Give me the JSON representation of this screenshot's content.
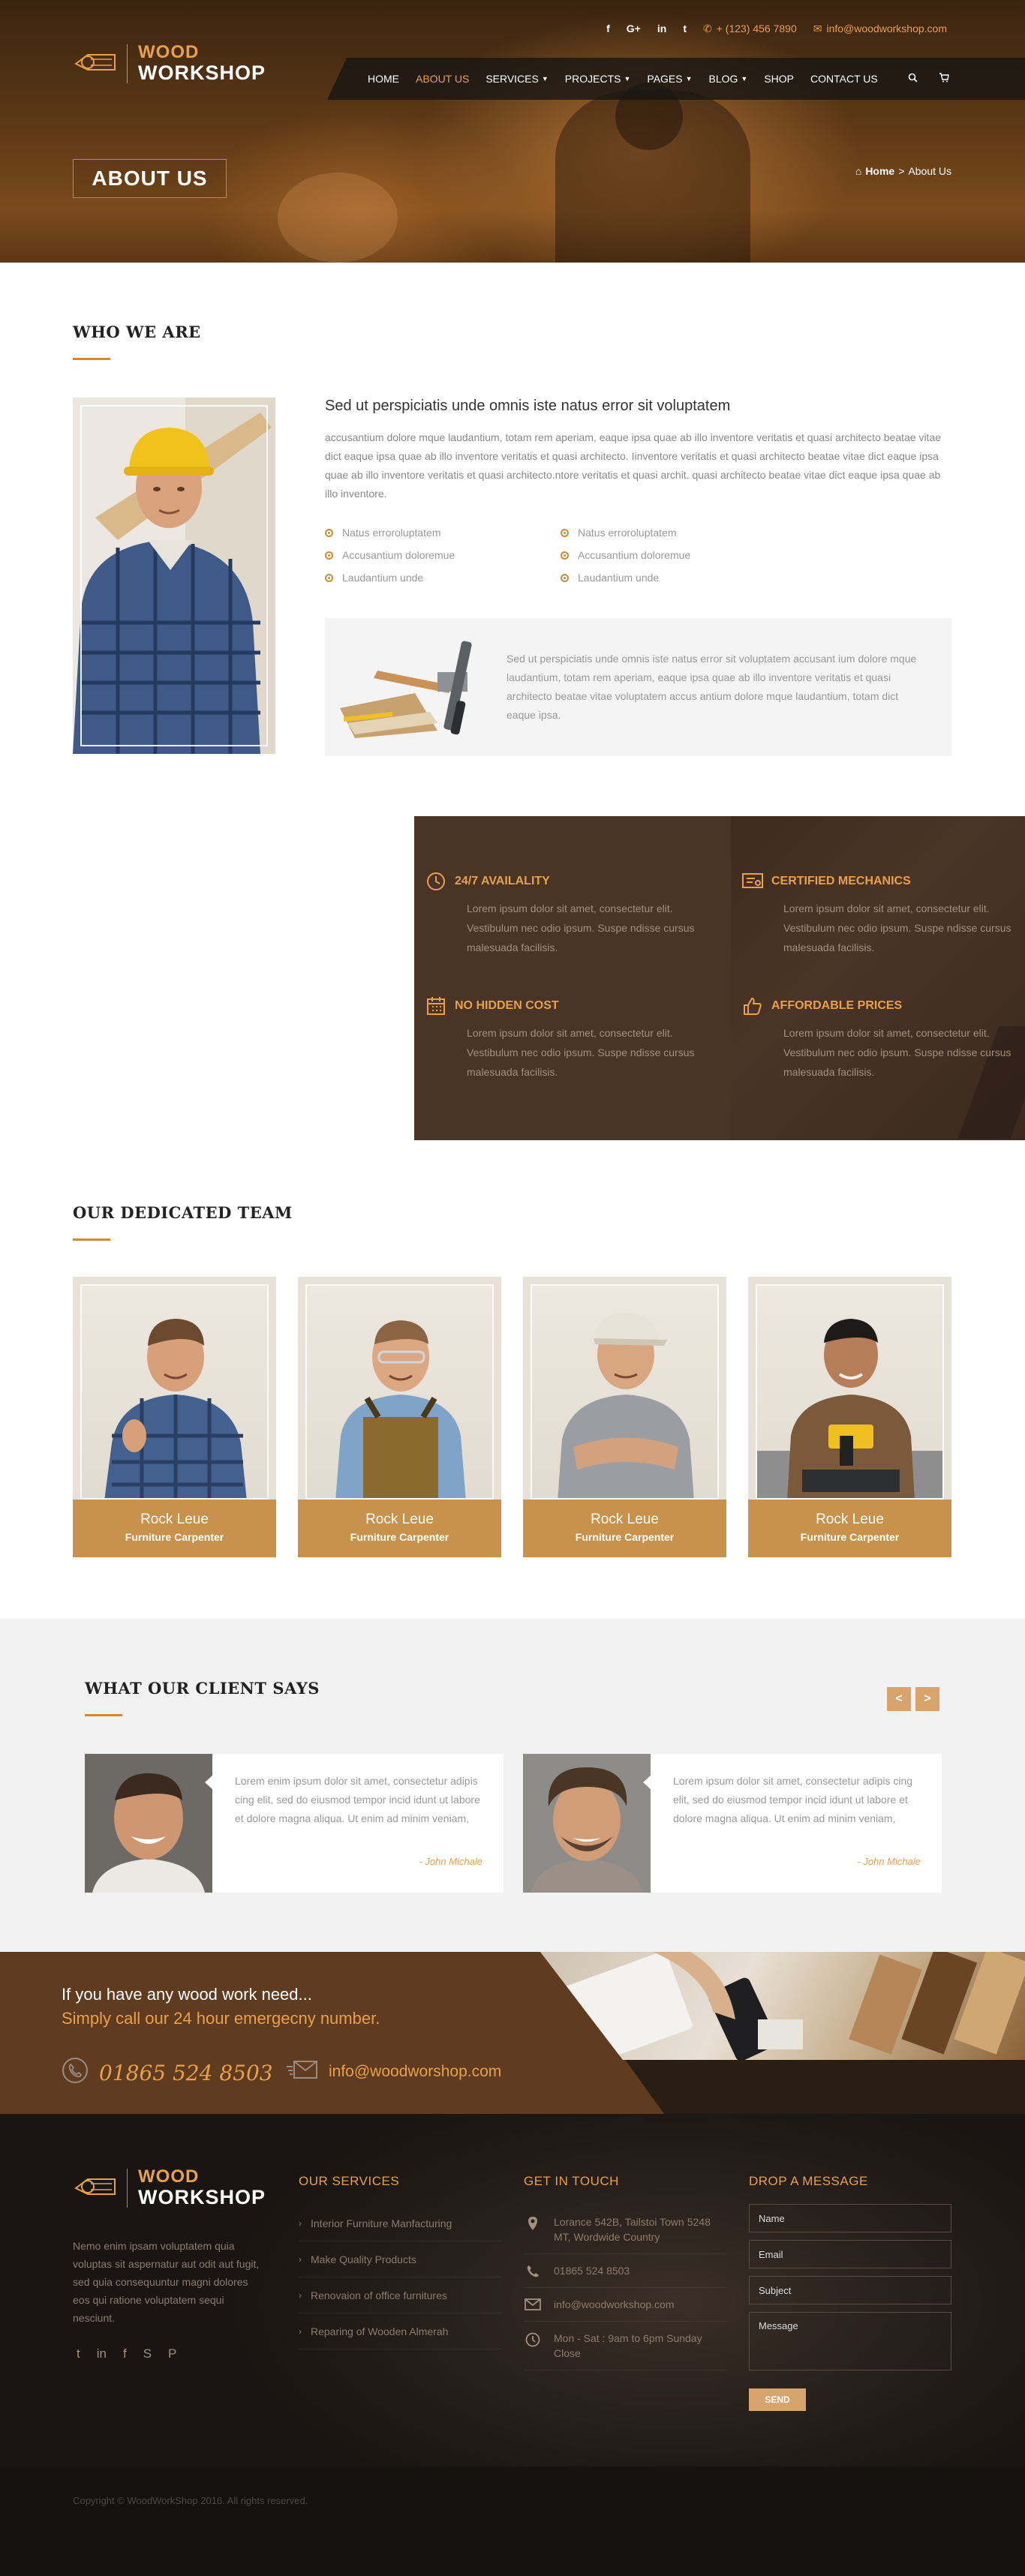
{
  "topbar": {
    "social_icons": [
      "facebook-icon",
      "google-plus-icon",
      "linkedin-icon",
      "twitter-icon"
    ],
    "social_glyphs": [
      "f",
      "G+",
      "in",
      "t"
    ],
    "phone": "+ (123) 456 7890",
    "email": "info@woodworkshop.com"
  },
  "brand": {
    "line1": "WOOD",
    "line2": "WORKSHOP"
  },
  "nav": {
    "items": [
      {
        "label": "HOME",
        "dropdown": false,
        "active": false
      },
      {
        "label": "ABOUT US",
        "dropdown": false,
        "active": true
      },
      {
        "label": "SERVICES",
        "dropdown": true,
        "active": false
      },
      {
        "label": "PROJECTS",
        "dropdown": true,
        "active": false
      },
      {
        "label": "PAGES",
        "dropdown": true,
        "active": false
      },
      {
        "label": "BLOG",
        "dropdown": true,
        "active": false
      },
      {
        "label": "SHOP",
        "dropdown": false,
        "active": false
      },
      {
        "label": "CONTACT US",
        "dropdown": false,
        "active": false
      }
    ]
  },
  "hero": {
    "title": "ABOUT US",
    "breadcrumb_home": "Home",
    "breadcrumb_sep": ">",
    "breadcrumb_current": "About Us"
  },
  "who": {
    "title": "WHO WE ARE",
    "heading": "Sed ut perspiciatis unde omnis iste natus error sit voluptatem",
    "paragraph": "accusantium dolore mque laudantium, totam rem aperiam, eaque ipsa quae ab illo inventore veritatis et quasi architecto beatae vitae dict eaque ipsa quae ab illo inventore veritatis et quasi architecto. Iinventore veritatis et quasi architecto beatae vitae dict eaque ipsa quae ab illo inventore veritatis et quasi architecto.ntore veritatis et quasi archit. quasi architecto beatae vitae dict eaque ipsa quae ab illo inventore.",
    "bullets": [
      "Natus erroroluptatem",
      "Natus erroroluptatem",
      "Accusantium doloremue",
      "Accusantium doloremue",
      "Laudantium unde",
      "Laudantium unde"
    ],
    "box_text": "Sed ut perspiciatis unde omnis iste natus error sit voluptatem accusant ium dolore mque laudantium, totam rem aperiam, eaque ipsa quae ab illo inventore veritatis et quasi architecto beatae vitae voluptatem accus antium dolore mque laudantium, totam dict eaque ipsa."
  },
  "features": [
    {
      "title": "24/7 AVAILALITY",
      "icon": "clock-icon",
      "text": "Lorem ipsum dolor sit amet, consectetur elit. Vestibulum nec odio ipsum. Suspe ndisse cursus malesuada facilisis."
    },
    {
      "title": "CERTIFIED MECHANICS",
      "icon": "certificate-icon",
      "text": "Lorem ipsum dolor sit amet, consectetur elit. Vestibulum nec odio ipsum. Suspe ndisse cursus malesuada facilisis."
    },
    {
      "title": "NO HIDDEN COST",
      "icon": "calendar-icon",
      "text": "Lorem ipsum dolor sit amet, consectetur elit. Vestibulum nec odio ipsum. Suspe ndisse cursus malesuada facilisis."
    },
    {
      "title": "AFFORDABLE PRICES",
      "icon": "thumbs-up-icon",
      "text": "Lorem ipsum dolor sit amet, consectetur elit. Vestibulum nec odio ipsum. Suspe ndisse cursus malesuada facilisis."
    }
  ],
  "team": {
    "title": "OUR DEDICATED TEAM",
    "members": [
      {
        "name": "Rock Leue",
        "role": "Furniture Carpenter"
      },
      {
        "name": "Rock Leue",
        "role": "Furniture Carpenter"
      },
      {
        "name": "Rock Leue",
        "role": "Furniture Carpenter"
      },
      {
        "name": "Rock Leue",
        "role": "Furniture Carpenter"
      }
    ]
  },
  "testimonials": {
    "title": "WHAT OUR CLIENT SAYS",
    "prev": "<",
    "next": ">",
    "items": [
      {
        "text": "Lorem enim ipsum dolor sit amet, consectetur adipis cing elit, sed do eiusmod tempor incid idunt ut labore et dolore magna aliqua. Ut enim ad minim veniam,",
        "author": "- John Michale"
      },
      {
        "text": "Lorem ipsum dolor sit amet, consectetur adipis cing elit, sed do eiusmod tempor incid idunt ut labore et dolore magna aliqua. Ut enim ad minim veniam,",
        "author": "- John Michale"
      }
    ]
  },
  "cta": {
    "line1": "If you have any wood work need...",
    "line2": "Simply call our 24 hour emergecny number.",
    "phone": "01865 524 8503",
    "email": "info@woodworshop.com"
  },
  "footer": {
    "about": "Nemo enim ipsam voluptatem quia voluptas sit aspernatur aut odit aut fugit, sed quia consequuntur magni dolores eos qui ratione voluptatem sequi nesciunt.",
    "social_icons": [
      "twitter-icon",
      "linkedin-icon",
      "facebook-icon",
      "skype-icon",
      "pinterest-icon"
    ],
    "social_glyphs": [
      "t",
      "in",
      "f",
      "S",
      "P"
    ],
    "services_title": "OUR SERVICES",
    "services": [
      "Interior Furniture Manfacturing",
      "Make Quality Products",
      "Renovaion of office furnitures",
      "Reparing of Wooden Almerah"
    ],
    "touch_title": "GET IN TOUCH",
    "address": "Lorance 542B, Tailstoi Town 5248 MT, Wordwide Country",
    "phone": "01865 524 8503",
    "email": "info@woodworkshop.com",
    "hours": "Mon - Sat : 9am to 6pm Sunday Close",
    "message_title": "DROP A MESSAGE",
    "form": {
      "name": "Name",
      "email": "Email",
      "subject": "Subject",
      "message": "Message",
      "send": "SEND"
    },
    "copyright": "Copyright © WoodWorkShop 2016. All rights reserved."
  },
  "colors": {
    "accent": "#e8a04a",
    "gold": "#c8924c",
    "dark_brown": "#4a3426",
    "footer_bg": "#221b17"
  }
}
